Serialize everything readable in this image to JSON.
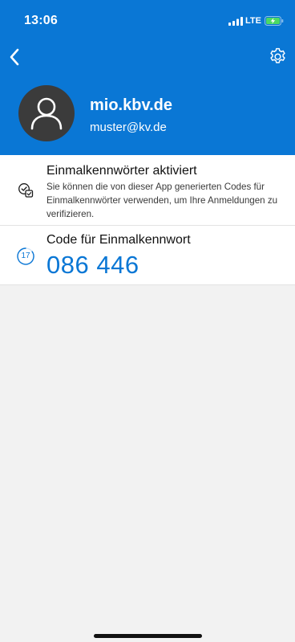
{
  "status_bar": {
    "time": "13:06",
    "network": "LTE",
    "signal_icon": "signal-bars-icon",
    "battery_icon": "battery-charging-icon"
  },
  "header": {
    "back_icon": "chevron-left-icon",
    "settings_icon": "gear-icon",
    "account_name": "mio.kbv.de",
    "account_email": "muster@kv.de",
    "background_color": "#0a77d5"
  },
  "info": {
    "icon": "verified-check-icon",
    "title": "Einmalkennwörter aktiviert",
    "description": "Sie können die von dieser App generierten Codes für Einmalkennwörter verwenden, um Ihre Anmeldungen zu verifizieren."
  },
  "code": {
    "label": "Code für Einmalkennwort",
    "value": "086 446",
    "timer_seconds": "17",
    "timer_icon": "countdown-ring-icon",
    "accent_color": "#0a77d5"
  }
}
